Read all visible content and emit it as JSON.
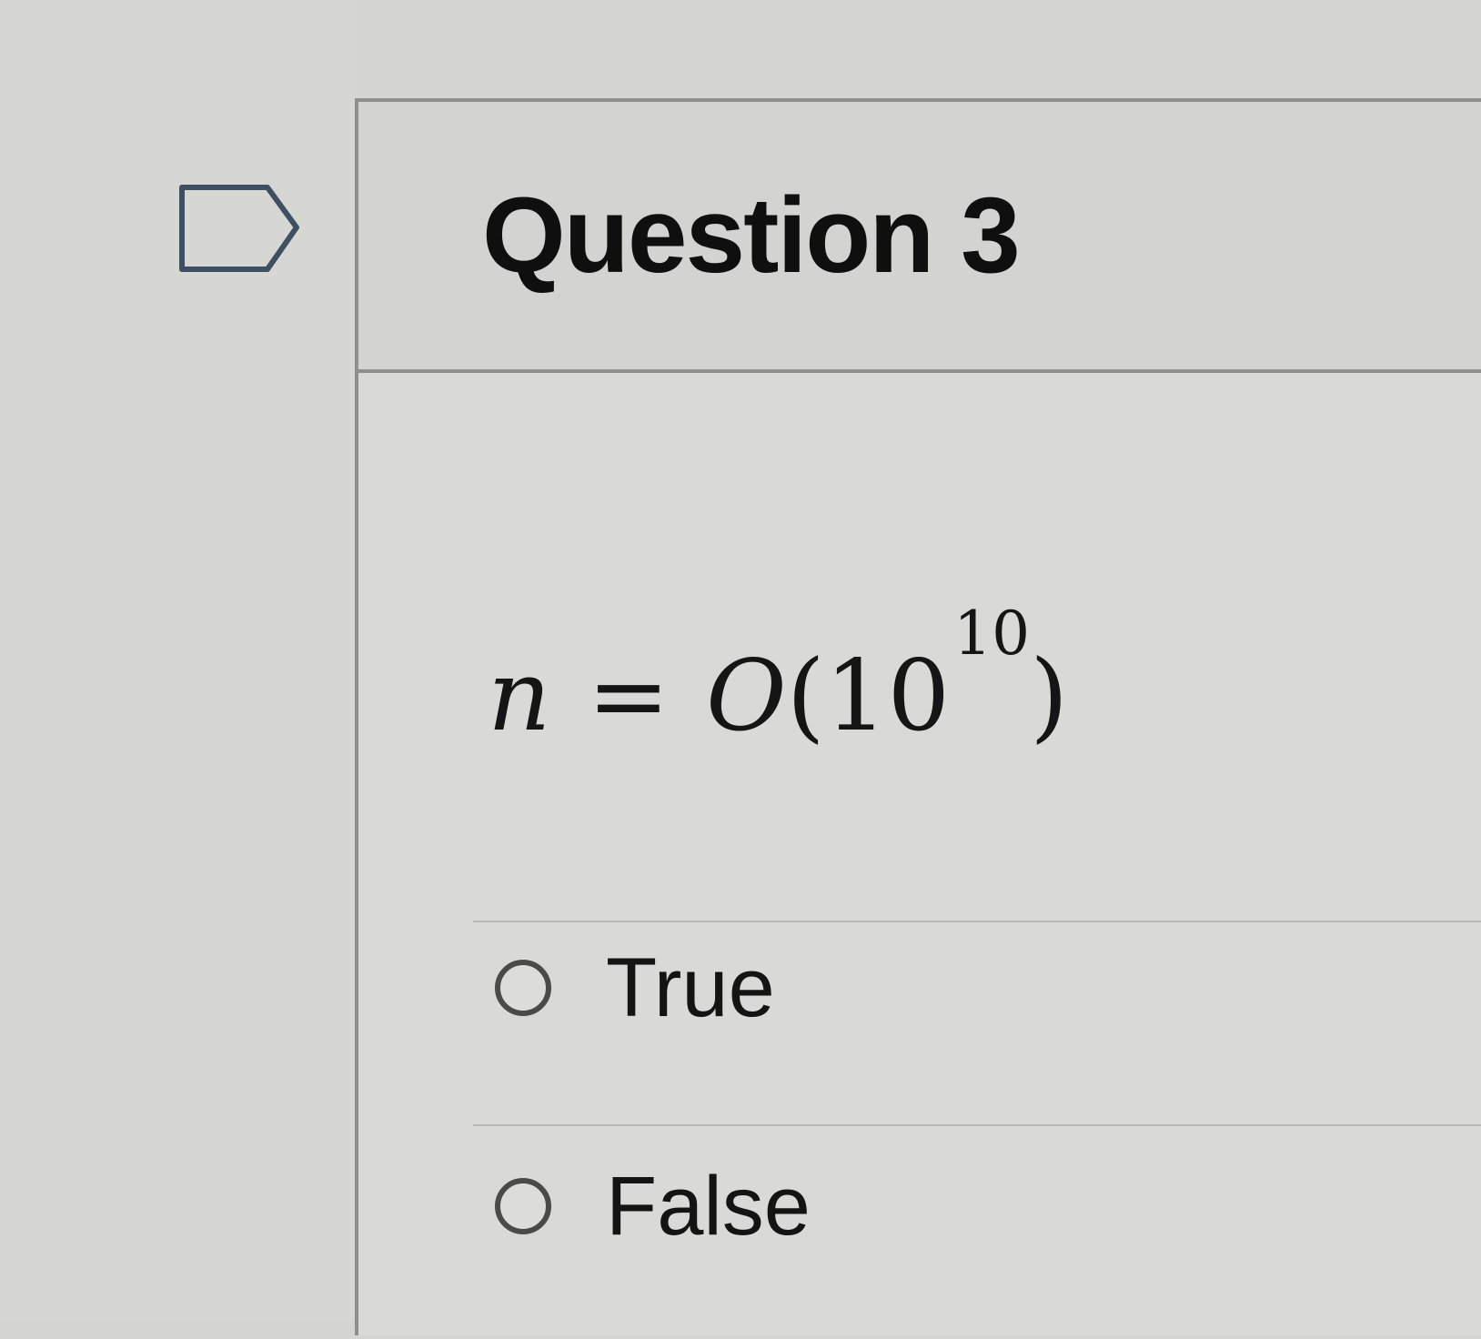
{
  "question": {
    "title": "Question 3",
    "flag_icon": "flag-outline-icon",
    "formula": {
      "variable": "n",
      "operator": "=",
      "function": "O",
      "open_paren": "(",
      "base": "10",
      "exponent": "10",
      "close_paren": ")"
    },
    "answers": [
      {
        "label": "True",
        "selected": false
      },
      {
        "label": "False",
        "selected": false
      }
    ]
  },
  "colors": {
    "page_background": "#d4d4d0",
    "card_border": "#8f8f8c",
    "text": "#141414",
    "radio_border": "#4a4a48"
  }
}
